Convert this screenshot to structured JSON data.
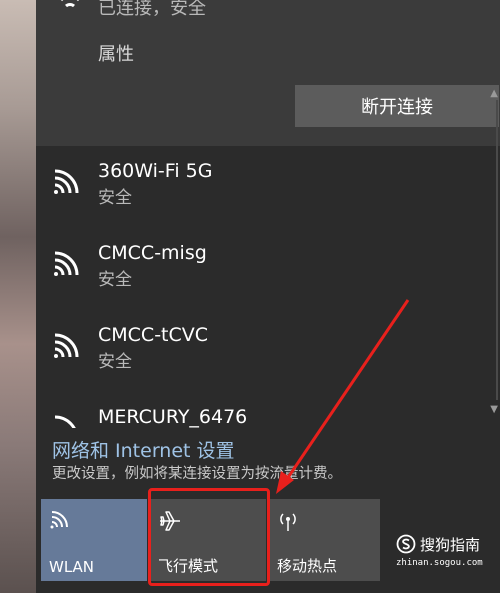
{
  "connected": {
    "status": "已连接，安全",
    "properties_label": "属性",
    "disconnect_label": "断开连接"
  },
  "networks": [
    {
      "name": "360Wi-Fi 5G",
      "security": "安全"
    },
    {
      "name": "CMCC-misg",
      "security": "安全"
    },
    {
      "name": "CMCC-tCVC",
      "security": "安全"
    },
    {
      "name": "MERCURY_6476",
      "security": ""
    }
  ],
  "settings": {
    "title": "网络和 Internet 设置",
    "subtitle": "更改设置，例如将某连接设置为按流量计费。"
  },
  "quick_actions": [
    {
      "label": "WLAN",
      "icon": "wifi-icon",
      "active": true
    },
    {
      "label": "飞行模式",
      "icon": "airplane-icon",
      "active": false
    },
    {
      "label": "移动热点",
      "icon": "hotspot-icon",
      "active": false
    }
  ],
  "watermark": {
    "brand": "搜狗指南",
    "url": "zhinan.sogou.com"
  },
  "colors": {
    "panel": "#2b2b2b",
    "connected_bg": "#3b3b3b",
    "link": "#9fc3e6",
    "wlan_active": "#667a99",
    "tile": "#4d4d4d",
    "annotation_red": "#e8201c"
  }
}
